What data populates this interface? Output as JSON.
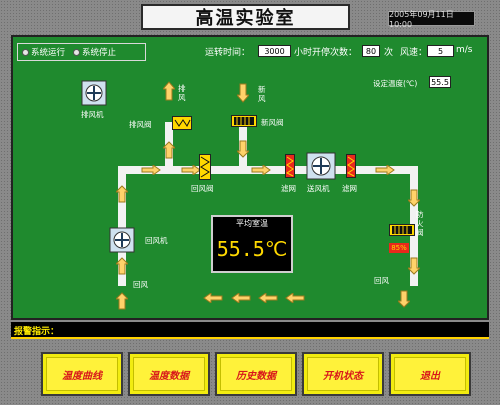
{
  "header": {
    "title": "高温实验室",
    "datetime": "2005年09月11日10:00"
  },
  "status": {
    "running": "系统运行",
    "stopped": "系统停止"
  },
  "params": {
    "runtime_label": "运转时间：",
    "runtime_value": "3000",
    "cycles_label": "小时开停次数：",
    "cycles_value": "80",
    "cycles_unit": "次",
    "speed_label": "风速：",
    "speed_value": "5",
    "speed_unit": "m/s",
    "setpoint_label": "设定温度(℃)",
    "setpoint_value": "55.5"
  },
  "labels": {
    "exhaust_fan": "排风机",
    "exhaust_valve": "排风阀",
    "exhaust_air": "排\n风",
    "fresh_air": "新\n风",
    "fresh_valve": "新风阀",
    "return_valve": "回风阀",
    "filter_1": "滤网",
    "supply_fan": "送风机",
    "filter_2": "滤网",
    "return_fan": "回风机",
    "return_air": "回风",
    "air_outlet": "回风",
    "anti_fire": "防\n火\n阀",
    "anti_fire_pct": "85%"
  },
  "avg_temp": {
    "title": "平均室温",
    "value": "55.5℃"
  },
  "alarm": {
    "label": "报警指示："
  },
  "buttons": [
    {
      "label": "温度曲线"
    },
    {
      "label": "温度数据"
    },
    {
      "label": "历史数据"
    },
    {
      "label": "开机状态"
    },
    {
      "label": "退出"
    }
  ]
}
